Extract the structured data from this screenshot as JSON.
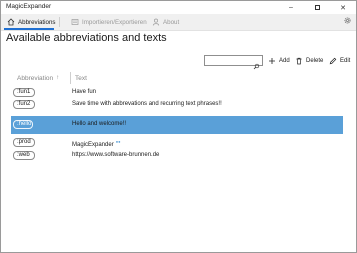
{
  "window": {
    "title": "MagicExpander",
    "controls": {
      "minimize": "–",
      "close": "✕"
    }
  },
  "nav": {
    "tabs": [
      {
        "label": "Abbreviations",
        "icon": "home-icon"
      },
      {
        "label": "Importieren/Exportieren",
        "icon": "import-export-icon"
      },
      {
        "label": "About",
        "icon": "person-icon"
      }
    ],
    "settings_icon": "gear-icon"
  },
  "page": {
    "title": "Available abbreviations and texts"
  },
  "toolbar": {
    "search": {
      "value": "",
      "placeholder": "",
      "icon": "search-icon"
    },
    "add_label": "Add",
    "delete_label": "Delete",
    "edit_label": "Edit"
  },
  "table": {
    "columns": [
      {
        "label": "Abbreviation",
        "sort": "↑"
      },
      {
        "label": "Text"
      }
    ],
    "rows": [
      {
        "abbr": ":fun1",
        "text": "Have fun",
        "selected": false
      },
      {
        "abbr": ":fun2",
        "text": "Save time with abbrevations and recurring text phrases!!",
        "selected": false
      },
      {
        "abbr": ":hello",
        "text": "Hello and welcome!!",
        "selected": true
      },
      {
        "abbr": ":prod",
        "text": "MagicExpander",
        "selected": false
      },
      {
        "abbr": ":web",
        "text": "https://www.software-brunnen.de",
        "selected": false
      }
    ]
  },
  "colors": {
    "accent": "#1f6fd1",
    "selection": "#5aa0d8"
  }
}
